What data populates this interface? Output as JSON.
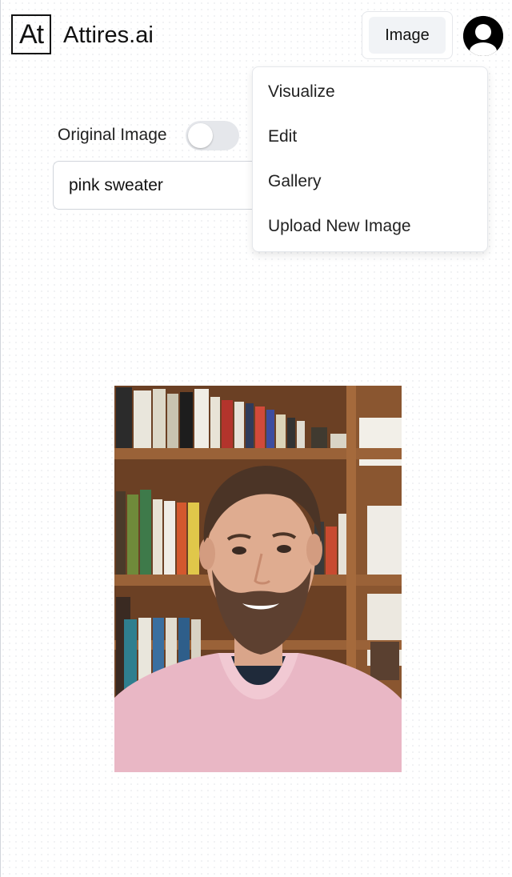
{
  "header": {
    "logo_text": "At",
    "brand": "Attires.ai",
    "image_button_label": "Image",
    "avatar_icon": "user-avatar-icon"
  },
  "menu": {
    "items": [
      {
        "label": "Visualize"
      },
      {
        "label": "Edit"
      },
      {
        "label": "Gallery"
      },
      {
        "label": "Upload New Image"
      }
    ]
  },
  "controls": {
    "toggle_label": "Original Image",
    "toggle_on": false,
    "prompt_value": "pink sweater"
  },
  "colors": {
    "accent_sweater": "#e9b7c5",
    "toggle_off": "#e5e7eb"
  }
}
